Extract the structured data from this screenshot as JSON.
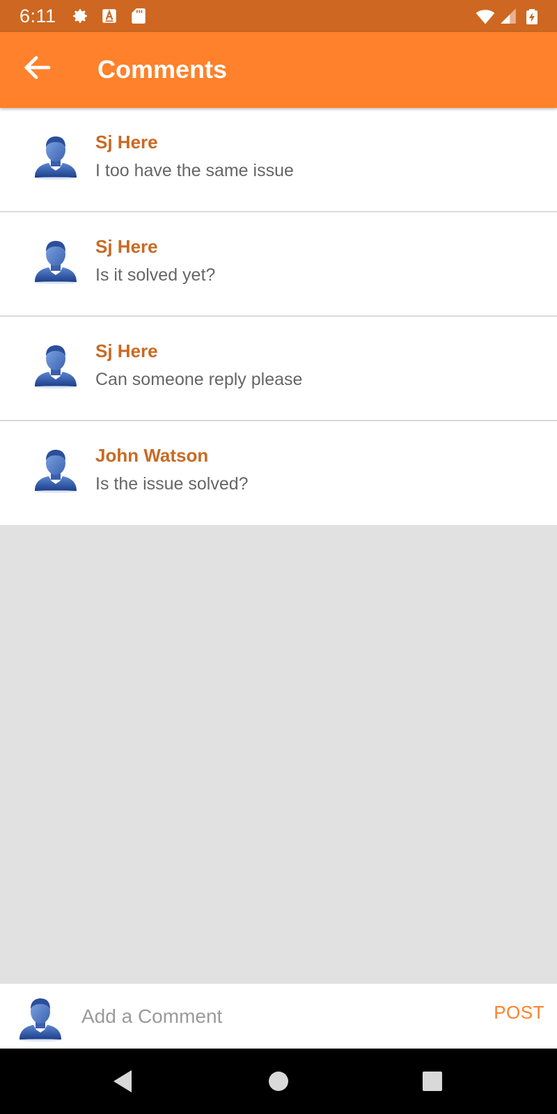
{
  "status_bar": {
    "time": "6:11",
    "icons": [
      "settings-icon",
      "a-badge-icon",
      "sd-card-icon",
      "wifi-icon",
      "signal-icon",
      "battery-charging-icon"
    ],
    "background": "#cd6721"
  },
  "app_bar": {
    "title": "Comments",
    "back_icon": "arrow-left-icon",
    "background": "#ff812b"
  },
  "comments": [
    {
      "author": "Sj Here",
      "text": "I too have the same issue",
      "avatar": "user-avatar-icon"
    },
    {
      "author": "Sj Here",
      "text": "Is it solved yet?",
      "avatar": "user-avatar-icon"
    },
    {
      "author": "Sj Here",
      "text": "Can someone reply please",
      "avatar": "user-avatar-icon"
    },
    {
      "author": "John Watson",
      "text": "Is the issue solved?",
      "avatar": "user-avatar-icon"
    }
  ],
  "composer": {
    "placeholder": "Add a Comment",
    "value": "",
    "post_label": "POST"
  },
  "nav_bar": {
    "icons": [
      "back-triangle-icon",
      "home-circle-icon",
      "recents-square-icon"
    ]
  },
  "colors": {
    "accent": "#ff812b",
    "author_name": "#c86a24",
    "comment_text": "#666666",
    "empty_area": "#e1e1e1"
  }
}
